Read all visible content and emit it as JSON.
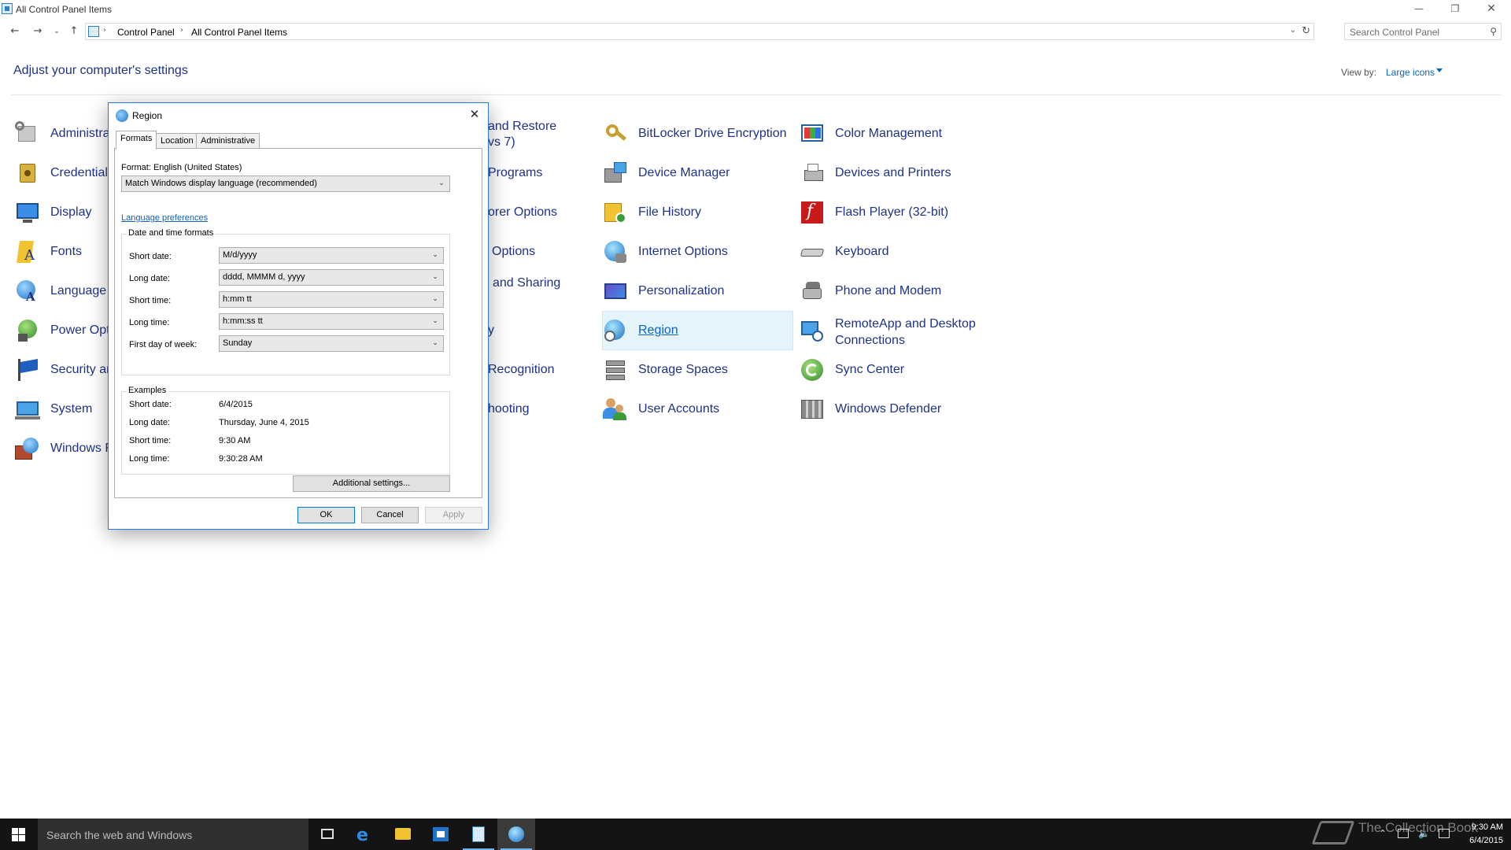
{
  "window": {
    "title": "All Control Panel Items",
    "min_glyph": "—",
    "max_glyph": "❐",
    "close_glyph": "✕"
  },
  "nav": {
    "back_glyph": "←",
    "forward_glyph": "→",
    "recent_glyph": "⌄",
    "up_glyph": "↑"
  },
  "address": {
    "crumbs": [
      "Control Panel",
      "All Control Panel Items"
    ],
    "separator": "›",
    "dropdown_glyph": "⌄",
    "refresh_glyph": "↻"
  },
  "search": {
    "placeholder": "Search Control Panel",
    "icon_glyph": "⚲"
  },
  "header": {
    "title": "Adjust your computer's settings",
    "view_by_label": "View by:",
    "view_by_value": "Large icons"
  },
  "items": {
    "col1": [
      {
        "label": "Administra",
        "icon": "admin-tools-icon"
      },
      {
        "label": "Credential",
        "icon": "credential-manager-icon"
      },
      {
        "label": "Display",
        "icon": "display-icon"
      },
      {
        "label": "Fonts",
        "icon": "fonts-icon"
      },
      {
        "label": "Language",
        "icon": "language-icon"
      },
      {
        "label": "Power Opti",
        "icon": "power-options-icon"
      },
      {
        "label": "Security an",
        "icon": "security-flag-icon"
      },
      {
        "label": "System",
        "icon": "system-icon"
      },
      {
        "label": "Windows F",
        "icon": "firewall-icon"
      }
    ],
    "col2_line1": [
      "and Restore",
      "Programs",
      "orer Options",
      "Options",
      "and Sharing",
      "y",
      "Recognition",
      "hooting"
    ],
    "col2_line2": "vs 7)",
    "col3": [
      {
        "label": "BitLocker Drive Encryption",
        "icon": "bitlocker-key-icon"
      },
      {
        "label": "Device Manager",
        "icon": "device-manager-icon"
      },
      {
        "label": "File History",
        "icon": "file-history-icon"
      },
      {
        "label": "Internet Options",
        "icon": "internet-options-icon"
      },
      {
        "label": "Personalization",
        "icon": "personalization-icon"
      },
      {
        "label": "Region",
        "icon": "region-globe-icon"
      },
      {
        "label": "Storage Spaces",
        "icon": "storage-spaces-icon"
      },
      {
        "label": "User Accounts",
        "icon": "user-accounts-icon"
      }
    ],
    "col4": [
      {
        "label": "Color Management",
        "icon": "color-management-icon"
      },
      {
        "label": "Devices and Printers",
        "icon": "devices-printers-icon"
      },
      {
        "label": "Flash Player (32-bit)",
        "icon": "flash-player-icon"
      },
      {
        "label": "Keyboard",
        "icon": "keyboard-icon"
      },
      {
        "label": "Phone and Modem",
        "icon": "phone-modem-icon"
      },
      {
        "label": "RemoteApp and Desktop Connections",
        "icon": "remoteapp-icon"
      },
      {
        "label": "Sync Center",
        "icon": "sync-center-icon"
      },
      {
        "label": "Windows Defender",
        "icon": "windows-defender-icon"
      }
    ]
  },
  "dialog": {
    "title": "Region",
    "close_glyph": "✕",
    "tabs": [
      "Formats",
      "Location",
      "Administrative"
    ],
    "format_label": "Format: English (United States)",
    "format_value": "Match Windows display language (recommended)",
    "language_link": "Language preferences",
    "datetime_group": "Date and time formats",
    "fields": [
      {
        "label": "Short date:",
        "value": "M/d/yyyy"
      },
      {
        "label": "Long date:",
        "value": "dddd, MMMM d, yyyy"
      },
      {
        "label": "Short time:",
        "value": "h:mm tt"
      },
      {
        "label": "Long time:",
        "value": "h:mm:ss tt"
      },
      {
        "label": "First day of week:",
        "value": "Sunday"
      }
    ],
    "examples_group": "Examples",
    "examples": [
      {
        "label": "Short date:",
        "value": "6/4/2015"
      },
      {
        "label": "Long date:",
        "value": "Thursday, June 4, 2015"
      },
      {
        "label": "Short time:",
        "value": "9:30 AM"
      },
      {
        "label": "Long time:",
        "value": "9:30:28 AM"
      }
    ],
    "additional_button": "Additional settings...",
    "ok_button": "OK",
    "cancel_button": "Cancel",
    "apply_button": "Apply",
    "dropdown_glyph": "⌄"
  },
  "taskbar": {
    "search_placeholder": "Search the web and Windows",
    "time": "9:30 AM",
    "date": "6/4/2015",
    "tray_up_glyph": "⌃",
    "tray_volume_glyph": "🔈"
  },
  "watermark": "The Collection Book",
  "colors": {
    "link_blue": "#0b63c1",
    "heading_blue": "#1e3287",
    "selection_bg": "#e5f3fb",
    "taskbar_bg": "#141414",
    "dialog_border": "#2b79d0"
  }
}
